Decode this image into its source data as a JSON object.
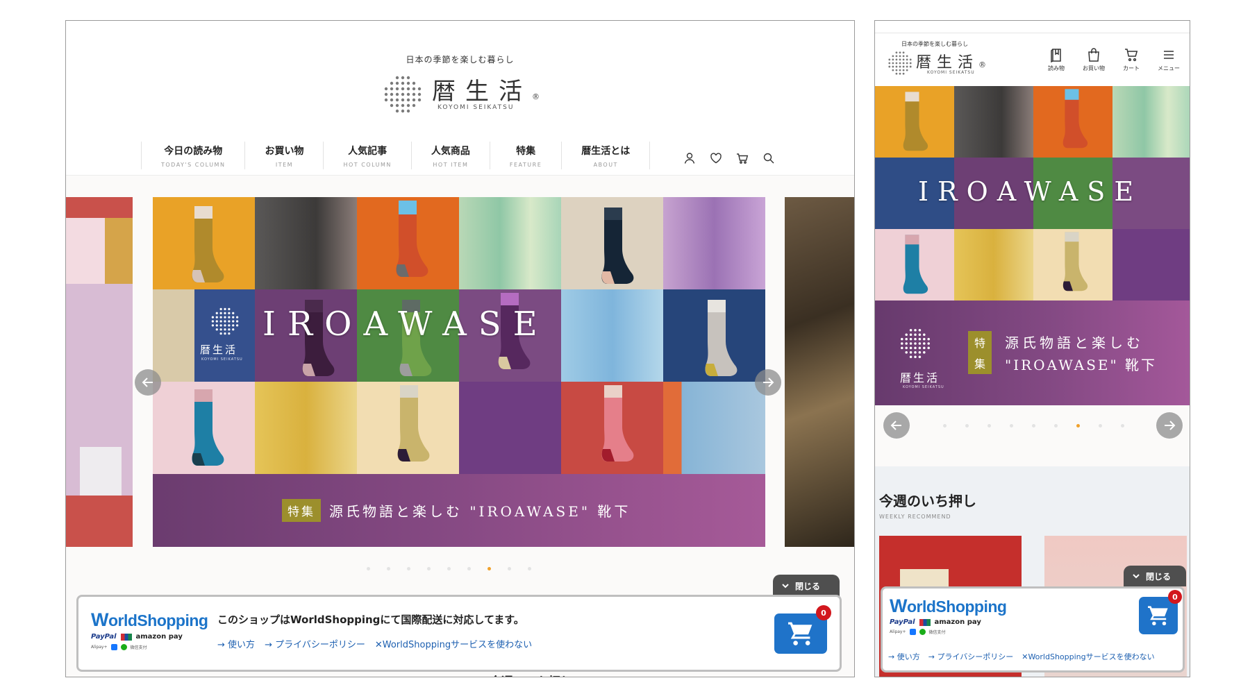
{
  "desktop": {
    "tagline": "日本の季節を楽しむ暮らし",
    "logo": {
      "name": "暦生活",
      "sub": "KOYOMI SEIKATSU",
      "reg": "®"
    },
    "nav": [
      {
        "jp": "今日の読み物",
        "en": "TODAY'S COLUMN"
      },
      {
        "jp": "お買い物",
        "en": "ITEM"
      },
      {
        "jp": "人気記事",
        "en": "HOT COLUMN"
      },
      {
        "jp": "人気商品",
        "en": "HOT ITEM"
      },
      {
        "jp": "特集",
        "en": "FEATURE"
      },
      {
        "jp": "暦生活とは",
        "en": "ABOUT"
      }
    ],
    "icons": [
      "user-icon",
      "heart-icon",
      "cart-icon",
      "search-icon"
    ],
    "slide": {
      "headline": "IROAWASE",
      "badge": "特集",
      "caption": "源氏物語と楽しむ \"IROAWASE\" 靴下",
      "logo_text": "暦生活",
      "logo_sub": "KOYOMI SEIKATSU"
    },
    "slider": {
      "dot_count": 9,
      "active_dot_index": 6
    },
    "below_fold_heading": "今週のいち押し"
  },
  "mobile": {
    "tagline": "日本の季節を楽しむ暮らし",
    "logo": {
      "name": "暦生活",
      "sub": "KOYOMI SEIKATSU",
      "reg": "®"
    },
    "header_icons": [
      {
        "icon": "book-icon",
        "label": "読み物"
      },
      {
        "icon": "bag-icon",
        "label": "お買い物"
      },
      {
        "icon": "cart-icon",
        "label": "カート"
      },
      {
        "icon": "menu-icon",
        "label": "メニュー"
      }
    ],
    "slide": {
      "headline": "IROAWASE",
      "badge_chars": [
        "特",
        "集"
      ],
      "caption_line1": "源氏物語と楽しむ",
      "caption_line2": "\"IROAWASE\" 靴下",
      "logo_text": "暦生活",
      "logo_sub": "KOYOMI SEIKATSU"
    },
    "slider": {
      "dot_count": 9,
      "active_dot_index": 6
    },
    "section": {
      "title": "今週のいち押し",
      "subtitle": "WEEKLY RECOMMEND"
    }
  },
  "worldshopping": {
    "brand": "WorldShopping",
    "brand_first": "W",
    "brand_rest": "orldShopping",
    "payments": [
      "PayPal",
      "amazon pay"
    ],
    "payments_small": [
      "Alipay+",
      "支付宝",
      "微信支付"
    ],
    "message": "このショップはWorldShoppingにて国際配送に対応してます。",
    "links": [
      {
        "icon": "→",
        "label": "使い方"
      },
      {
        "icon": "→",
        "label": "プライバシーポリシー"
      },
      {
        "icon": "✕",
        "label": "WorldShoppingサービスを使わない"
      }
    ],
    "close_label": "閉じる",
    "cart_count": "0"
  },
  "colors": {
    "accent_orange": "#f0a12b",
    "ws_blue": "#1f73c9",
    "badge_red": "#d2171d",
    "banner_purple": "#874a84",
    "badge_gold": "#9c8f2c"
  }
}
